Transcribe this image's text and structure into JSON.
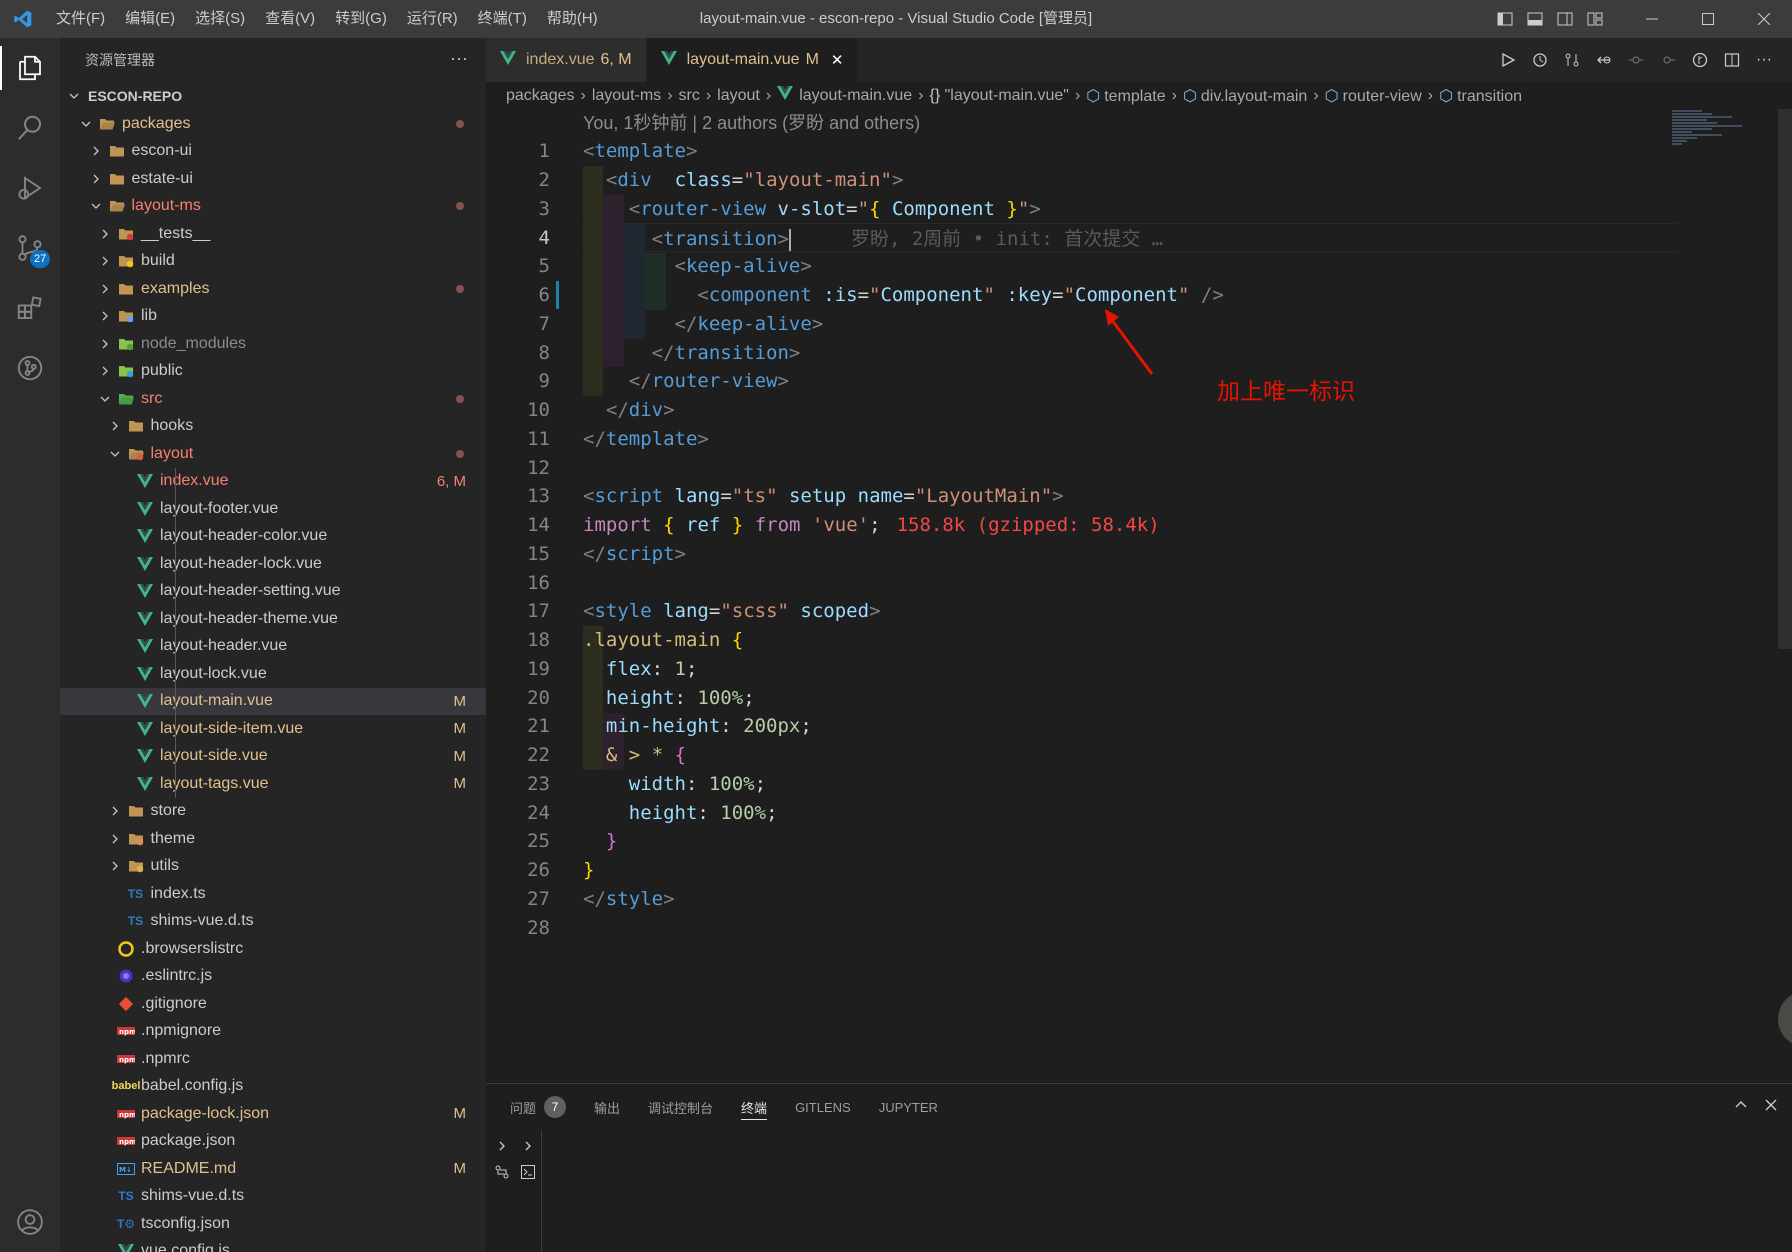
{
  "titlebar": {
    "title": "layout-main.vue - escon-repo - Visual Studio Code [管理员]",
    "menu": [
      "文件(F)",
      "编辑(E)",
      "选择(S)",
      "查看(V)",
      "转到(G)",
      "运行(R)",
      "终端(T)",
      "帮助(H)"
    ]
  },
  "activity": {
    "source_control_badge": "27"
  },
  "sidebar": {
    "title": "资源管理器",
    "more": "···",
    "root": "ESCON-REPO",
    "tree": [
      {
        "label": "packages",
        "depth": 1,
        "chev": "down",
        "icon": "folder-open",
        "state": "orng",
        "dot": true
      },
      {
        "label": "escon-ui",
        "depth": 2,
        "chev": "right",
        "icon": "folder",
        "state": ""
      },
      {
        "label": "estate-ui",
        "depth": 2,
        "chev": "right",
        "icon": "folder",
        "state": ""
      },
      {
        "label": "layout-ms",
        "depth": 2,
        "chev": "down",
        "icon": "folder-open",
        "state": "err",
        "dot": true
      },
      {
        "label": "__tests__",
        "depth": 3,
        "chev": "right",
        "icon": "folder-test",
        "state": ""
      },
      {
        "label": "build",
        "depth": 3,
        "chev": "right",
        "icon": "folder-build",
        "state": ""
      },
      {
        "label": "examples",
        "depth": 3,
        "chev": "right",
        "icon": "folder",
        "state": "orng",
        "dot": true
      },
      {
        "label": "lib",
        "depth": 3,
        "chev": "right",
        "icon": "folder-lib",
        "state": ""
      },
      {
        "label": "node_modules",
        "depth": 3,
        "chev": "right",
        "icon": "folder-node",
        "state": "dim"
      },
      {
        "label": "public",
        "depth": 3,
        "chev": "right",
        "icon": "folder-public",
        "state": ""
      },
      {
        "label": "src",
        "depth": 3,
        "chev": "down",
        "icon": "folder-src",
        "state": "err",
        "dot": true
      },
      {
        "label": "hooks",
        "depth": 4,
        "chev": "right",
        "icon": "folder",
        "state": ""
      },
      {
        "label": "layout",
        "depth": 4,
        "chev": "down",
        "icon": "folder-layout",
        "state": "err",
        "dot": true
      },
      {
        "label": "index.vue",
        "depth": 5,
        "icon": "vue",
        "state": "err",
        "dec": "6, M",
        "decerr": true
      },
      {
        "label": "layout-footer.vue",
        "depth": 5,
        "icon": "vue",
        "state": ""
      },
      {
        "label": "layout-header-color.vue",
        "depth": 5,
        "icon": "vue",
        "state": ""
      },
      {
        "label": "layout-header-lock.vue",
        "depth": 5,
        "icon": "vue",
        "state": ""
      },
      {
        "label": "layout-header-setting.vue",
        "depth": 5,
        "icon": "vue",
        "state": ""
      },
      {
        "label": "layout-header-theme.vue",
        "depth": 5,
        "icon": "vue",
        "state": ""
      },
      {
        "label": "layout-header.vue",
        "depth": 5,
        "icon": "vue",
        "state": ""
      },
      {
        "label": "layout-lock.vue",
        "depth": 5,
        "icon": "vue",
        "state": ""
      },
      {
        "label": "layout-main.vue",
        "depth": 5,
        "icon": "vue",
        "state": "mod",
        "dec": "M",
        "selected": true
      },
      {
        "label": "layout-side-item.vue",
        "depth": 5,
        "icon": "vue",
        "state": "mod",
        "dec": "M"
      },
      {
        "label": "layout-side.vue",
        "depth": 5,
        "icon": "vue",
        "state": "mod",
        "dec": "M"
      },
      {
        "label": "layout-tags.vue",
        "depth": 5,
        "icon": "vue",
        "state": "mod",
        "dec": "M"
      },
      {
        "label": "store",
        "depth": 4,
        "chev": "right",
        "icon": "folder",
        "state": ""
      },
      {
        "label": "theme",
        "depth": 4,
        "chev": "right",
        "icon": "folder-theme",
        "state": ""
      },
      {
        "label": "utils",
        "depth": 4,
        "chev": "right",
        "icon": "folder-utils",
        "state": ""
      },
      {
        "label": "index.ts",
        "depth": 4,
        "icon": "ts",
        "state": ""
      },
      {
        "label": "shims-vue.d.ts",
        "depth": 4,
        "icon": "ts",
        "state": ""
      },
      {
        "label": ".browserslistrc",
        "depth": 3,
        "icon": "browserslist",
        "state": ""
      },
      {
        "label": ".eslintrc.js",
        "depth": 3,
        "icon": "eslint",
        "state": ""
      },
      {
        "label": ".gitignore",
        "depth": 3,
        "icon": "git",
        "state": ""
      },
      {
        "label": ".npmignore",
        "depth": 3,
        "icon": "npm",
        "state": ""
      },
      {
        "label": ".npmrc",
        "depth": 3,
        "icon": "npm",
        "state": ""
      },
      {
        "label": "babel.config.js",
        "depth": 3,
        "icon": "babel",
        "state": ""
      },
      {
        "label": "package-lock.json",
        "depth": 3,
        "icon": "npm",
        "state": "mod",
        "dec": "M"
      },
      {
        "label": "package.json",
        "depth": 3,
        "icon": "npm",
        "state": ""
      },
      {
        "label": "README.md",
        "depth": 3,
        "icon": "md",
        "state": "mod",
        "dec": "M"
      },
      {
        "label": "shims-vue.d.ts",
        "depth": 3,
        "icon": "ts",
        "state": ""
      },
      {
        "label": "tsconfig.json",
        "depth": 3,
        "icon": "tsconfig",
        "state": ""
      },
      {
        "label": "vue.config.js",
        "depth": 3,
        "icon": "vue",
        "state": ""
      }
    ]
  },
  "tabs": [
    {
      "label": "index.vue",
      "mark": "6, M",
      "active": false
    },
    {
      "label": "layout-main.vue",
      "mark": "M",
      "active": true,
      "close": "✕"
    }
  ],
  "breadcrumb": [
    "packages",
    "layout-ms",
    "src",
    "layout",
    "layout-main.vue",
    "\"layout-main.vue\"",
    "template",
    "div.layout-main",
    "router-view",
    "transition"
  ],
  "editor": {
    "blame_header": "You, 1秒钟前 | 2 authors (罗盼 and others)",
    "current_line": 4,
    "inline_blame": "罗盼, 2周前 • init: 首次提交 …",
    "import_size": "158.8k (gzipped: 58.4k)",
    "annotation": "加上唯一标识",
    "lines": [
      [
        [
          "t-br",
          "<"
        ],
        [
          "t-tag",
          "template"
        ],
        [
          "t-br",
          ">"
        ]
      ],
      [
        [
          "",
          "  "
        ],
        [
          "t-br",
          "<"
        ],
        [
          "t-tag",
          "div"
        ],
        [
          "",
          "  "
        ],
        [
          "t-attr",
          "class"
        ],
        [
          "",
          "="
        ],
        [
          "t-str",
          "\"layout-main\""
        ],
        [
          "t-br",
          ">"
        ]
      ],
      [
        [
          "",
          "    "
        ],
        [
          "t-br",
          "<"
        ],
        [
          "t-tag",
          "router-view"
        ],
        [
          "",
          " "
        ],
        [
          "t-attr",
          "v-slot"
        ],
        [
          "",
          "="
        ],
        [
          "t-str",
          "\""
        ],
        [
          "t-y",
          "{"
        ],
        [
          "",
          " "
        ],
        [
          "t-var",
          "Component"
        ],
        [
          "",
          " "
        ],
        [
          "t-y",
          "}"
        ],
        [
          "t-str",
          "\""
        ],
        [
          "t-br",
          ">"
        ]
      ],
      [
        [
          "",
          "      "
        ],
        [
          "t-br",
          "<"
        ],
        [
          "t-tag",
          "transition"
        ],
        [
          "t-br",
          ">"
        ]
      ],
      [
        [
          "",
          "        "
        ],
        [
          "t-br",
          "<"
        ],
        [
          "t-tag",
          "keep-alive"
        ],
        [
          "t-br",
          ">"
        ]
      ],
      [
        [
          "",
          "          "
        ],
        [
          "t-br",
          "<"
        ],
        [
          "t-tag",
          "component"
        ],
        [
          "",
          " "
        ],
        [
          "t-attr",
          ":is"
        ],
        [
          "",
          "="
        ],
        [
          "t-str",
          "\""
        ],
        [
          "t-var",
          "Component"
        ],
        [
          "t-str",
          "\""
        ],
        [
          "",
          " "
        ],
        [
          "t-attr",
          ":key"
        ],
        [
          "",
          "="
        ],
        [
          "t-str",
          "\""
        ],
        [
          "t-var",
          "Component"
        ],
        [
          "t-str",
          "\""
        ],
        [
          "",
          " "
        ],
        [
          "t-br",
          "/>"
        ]
      ],
      [
        [
          "",
          "        "
        ],
        [
          "t-br",
          "</"
        ],
        [
          "t-tag",
          "keep-alive"
        ],
        [
          "t-br",
          ">"
        ]
      ],
      [
        [
          "",
          "      "
        ],
        [
          "t-br",
          "</"
        ],
        [
          "t-tag",
          "transition"
        ],
        [
          "t-br",
          ">"
        ]
      ],
      [
        [
          "",
          "    "
        ],
        [
          "t-br",
          "</"
        ],
        [
          "t-tag",
          "router-view"
        ],
        [
          "t-br",
          ">"
        ]
      ],
      [
        [
          "",
          "  "
        ],
        [
          "t-br",
          "</"
        ],
        [
          "t-tag",
          "div"
        ],
        [
          "t-br",
          ">"
        ]
      ],
      [
        [
          "t-br",
          "</"
        ],
        [
          "t-tag",
          "template"
        ],
        [
          "t-br",
          ">"
        ]
      ],
      [],
      [
        [
          "t-br",
          "<"
        ],
        [
          "t-tag",
          "script"
        ],
        [
          "",
          " "
        ],
        [
          "t-attr",
          "lang"
        ],
        [
          "",
          "="
        ],
        [
          "t-str",
          "\"ts\""
        ],
        [
          "",
          " "
        ],
        [
          "t-attr",
          "setup"
        ],
        [
          "",
          " "
        ],
        [
          "t-attr",
          "name"
        ],
        [
          "",
          "="
        ],
        [
          "t-str",
          "\"LayoutMain\""
        ],
        [
          "t-br",
          ">"
        ]
      ],
      [
        [
          "t-kw",
          "import"
        ],
        [
          "",
          " "
        ],
        [
          "t-y",
          "{"
        ],
        [
          "",
          " "
        ],
        [
          "t-var",
          "ref"
        ],
        [
          "",
          " "
        ],
        [
          "t-y",
          "}"
        ],
        [
          "",
          " "
        ],
        [
          "t-kw",
          "from"
        ],
        [
          "",
          " "
        ],
        [
          "t-str",
          "'vue'"
        ],
        [
          "",
          ";"
        ]
      ],
      [
        [
          "t-br",
          "</"
        ],
        [
          "t-tag",
          "script"
        ],
        [
          "t-br",
          ">"
        ]
      ],
      [],
      [
        [
          "t-br",
          "<"
        ],
        [
          "t-tag",
          "style"
        ],
        [
          "",
          " "
        ],
        [
          "t-attr",
          "lang"
        ],
        [
          "",
          "="
        ],
        [
          "t-str",
          "\"scss\""
        ],
        [
          "",
          " "
        ],
        [
          "t-attr",
          "scoped"
        ],
        [
          "t-br",
          ">"
        ]
      ],
      [
        [
          "t-sel",
          ".layout-main"
        ],
        [
          "",
          " "
        ],
        [
          "t-y",
          "{"
        ]
      ],
      [
        [
          "",
          "  "
        ],
        [
          "t-attr",
          "flex"
        ],
        [
          "",
          ": "
        ],
        [
          "t-num",
          "1"
        ],
        [
          "",
          ";"
        ]
      ],
      [
        [
          "",
          "  "
        ],
        [
          "t-attr",
          "height"
        ],
        [
          "",
          ": "
        ],
        [
          "t-num",
          "100%"
        ],
        [
          "",
          ";"
        ]
      ],
      [
        [
          "",
          "  "
        ],
        [
          "t-attr",
          "min-height"
        ],
        [
          "",
          ": "
        ],
        [
          "t-num",
          "200px"
        ],
        [
          "",
          ";"
        ]
      ],
      [
        [
          "",
          "  "
        ],
        [
          "t-sel",
          "&"
        ],
        [
          "",
          " "
        ],
        [
          "t-sel",
          ">"
        ],
        [
          "",
          " "
        ],
        [
          "t-sel",
          "*"
        ],
        [
          "",
          " "
        ],
        [
          "t-p",
          "{"
        ]
      ],
      [
        [
          "",
          "    "
        ],
        [
          "t-attr",
          "width"
        ],
        [
          "",
          ": "
        ],
        [
          "t-num",
          "100%"
        ],
        [
          "",
          ";"
        ]
      ],
      [
        [
          "",
          "    "
        ],
        [
          "t-attr",
          "height"
        ],
        [
          "",
          ": "
        ],
        [
          "t-num",
          "100%"
        ],
        [
          "",
          ";"
        ]
      ],
      [
        [
          "",
          "  "
        ],
        [
          "t-p",
          "}"
        ]
      ],
      [
        [
          "t-y",
          "}"
        ]
      ],
      [
        [
          "t-br",
          "</"
        ],
        [
          "t-tag",
          "style"
        ],
        [
          "t-br",
          ">"
        ]
      ],
      []
    ]
  },
  "panel": {
    "tabs": [
      "问题",
      "输出",
      "调试控制台",
      "终端",
      "GITLENS",
      "JUPYTER"
    ],
    "problems_count": "7",
    "active_tab": "终端"
  }
}
